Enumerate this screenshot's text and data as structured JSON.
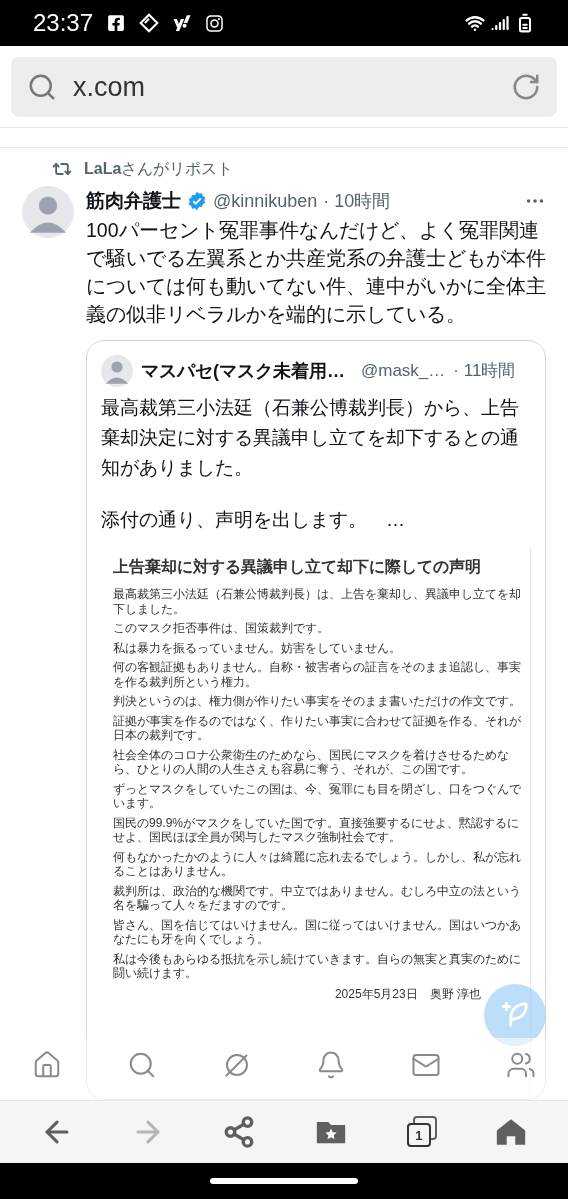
{
  "status_bar": {
    "time": "23:37"
  },
  "address_bar": {
    "url": "x.com"
  },
  "post": {
    "repost_label": "**LaLa**さんがリポスト",
    "author": "筋肉弁護士",
    "verified": true,
    "handle": "@kinnikuben",
    "time": "· 10時間",
    "text": "100パーセント冤罪事件なんだけど、よく冤罪関連で騒いでる左翼系とか共産党系の弁護士どもが本件については何も動いてない件、連中がいかに全体主義の似非リベラルかを端的に示している。",
    "quote": {
      "author": "マスパセ(マスク未着用…",
      "handle": "@mask_…",
      "time": "· 11時間",
      "paragraphs": [
        "最高裁第三小法廷（石兼公博裁判長）から、上告棄却決定に対する異議申し立てを却下するとの通知がありました。",
        "添付の通り、声明を出します。　…"
      ],
      "document": {
        "title": "上告棄却に対する異議申し立て却下に際しての声明",
        "paragraphs": [
          "最高裁第三小法廷（石兼公博裁判長）は、上告を棄却し、異議申し立てを却下しました。",
          "このマスク拒否事件は、国策裁判です。",
          "私は暴力を振るっていません。妨害をしていません。",
          "何の客観証拠もありません。自称・被害者らの証言をそのまま追認し、事実を作る裁判所という権力。",
          "判決というのは、権力側が作りたい事実をそのまま書いただけの作文です。",
          "証拠が事実を作るのではなく、作りたい事実に合わせて証拠を作る、それが日本の裁判です。",
          "社会全体のコロナ公衆衛生のためなら、国民にマスクを着けさせるためなら、ひとりの人間の人生さえも容易に奪う、それが、この国です。",
          "ずっとマスクをしていたこの国は、今、冤罪にも目を閉ざし、口をつぐんでいます。",
          "国民の99.9%がマスクをしていた国です。直接強要するにせよ、黙認するにせよ、国民ほぼ全員が関与したマスク強制社会です。",
          "何もなかったかのように人々は綺麗に忘れ去るでしょう。しかし、私が忘れることはありません。",
          "裁判所は、政治的な機関です。中立ではありません。むしろ中立の法という名を騙って人々をだますのです。",
          "皆さん、国を信じてはいけません。国に従ってはいけません。国はいつかあなたにも牙を向くでしょう。",
          "私は今後もあらゆる抵抗を示し続けていきます。自らの無実と真実のために闘い続けます。"
        ],
        "signature": "2025年5月23日　奥野 淳也"
      }
    }
  },
  "x_nav": [
    {
      "kind": "home"
    },
    {
      "kind": "search"
    },
    {
      "kind": "grok"
    },
    {
      "kind": "notifications"
    },
    {
      "kind": "messages"
    },
    {
      "kind": "communities"
    }
  ],
  "browser_toolbar": [
    {
      "kind": "back",
      "disabled": false
    },
    {
      "kind": "forward",
      "disabled": true
    },
    {
      "kind": "share",
      "disabled": false
    },
    {
      "kind": "bookmarks",
      "disabled": false
    },
    {
      "kind": "tabs",
      "count": "1",
      "disabled": false
    },
    {
      "kind": "home",
      "disabled": false
    }
  ]
}
